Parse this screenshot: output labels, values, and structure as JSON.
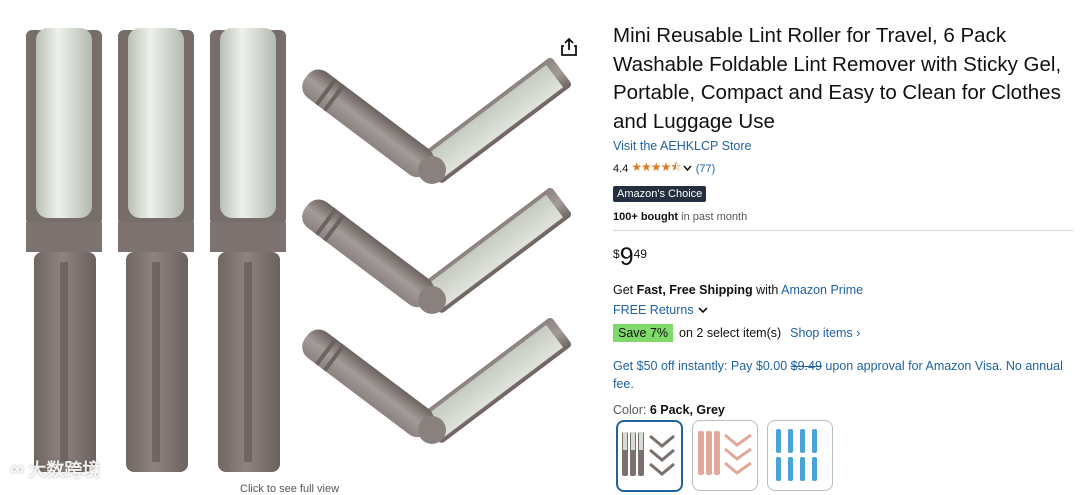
{
  "gallery": {
    "zoom_hint": "Click to see full view",
    "watermark": "大数跨境",
    "watermark_logo": "∞"
  },
  "product": {
    "title": "Mini Reusable Lint Roller for Travel, 6 Pack Washable Foldable Lint Remover with Sticky Gel, Portable, Compact and Easy to Clean for Clothes and Luggage Use",
    "store_link": "Visit the AEHKLCP Store",
    "rating": "4.4",
    "stars": "★★★★⯪",
    "review_count": "(77)",
    "badge": "Amazon's Choice",
    "bought_bold": "100+ bought",
    "bought_rest": " in past month"
  },
  "price": {
    "symbol": "$",
    "whole": "9",
    "fraction": "49"
  },
  "shipping": {
    "prefix": "Get ",
    "bold": "Fast, Free Shipping",
    "middle": " with ",
    "prime": "Amazon Prime",
    "returns": "FREE Returns"
  },
  "savings": {
    "badge": "Save 7%",
    "text": "on 2 select item(s)",
    "shop_items": "Shop items ›"
  },
  "offer": {
    "pre": "Get $50 off instantly: Pay $0.00 ",
    "strike": "$9.49",
    "post": " upon approval for Amazon Visa. No annual fee."
  },
  "color": {
    "label": "Color: ",
    "selected": "6 Pack, Grey"
  },
  "colors": {
    "roller_body": "#857b77",
    "roller_dark": "#6f6561",
    "roller_gel": "#d6dbd3",
    "accent_pink": "#e2a89a",
    "accent_blue": "#4aa3d8",
    "link": "#2162a1",
    "save_green": "#7fda69",
    "star": "#de7921"
  }
}
